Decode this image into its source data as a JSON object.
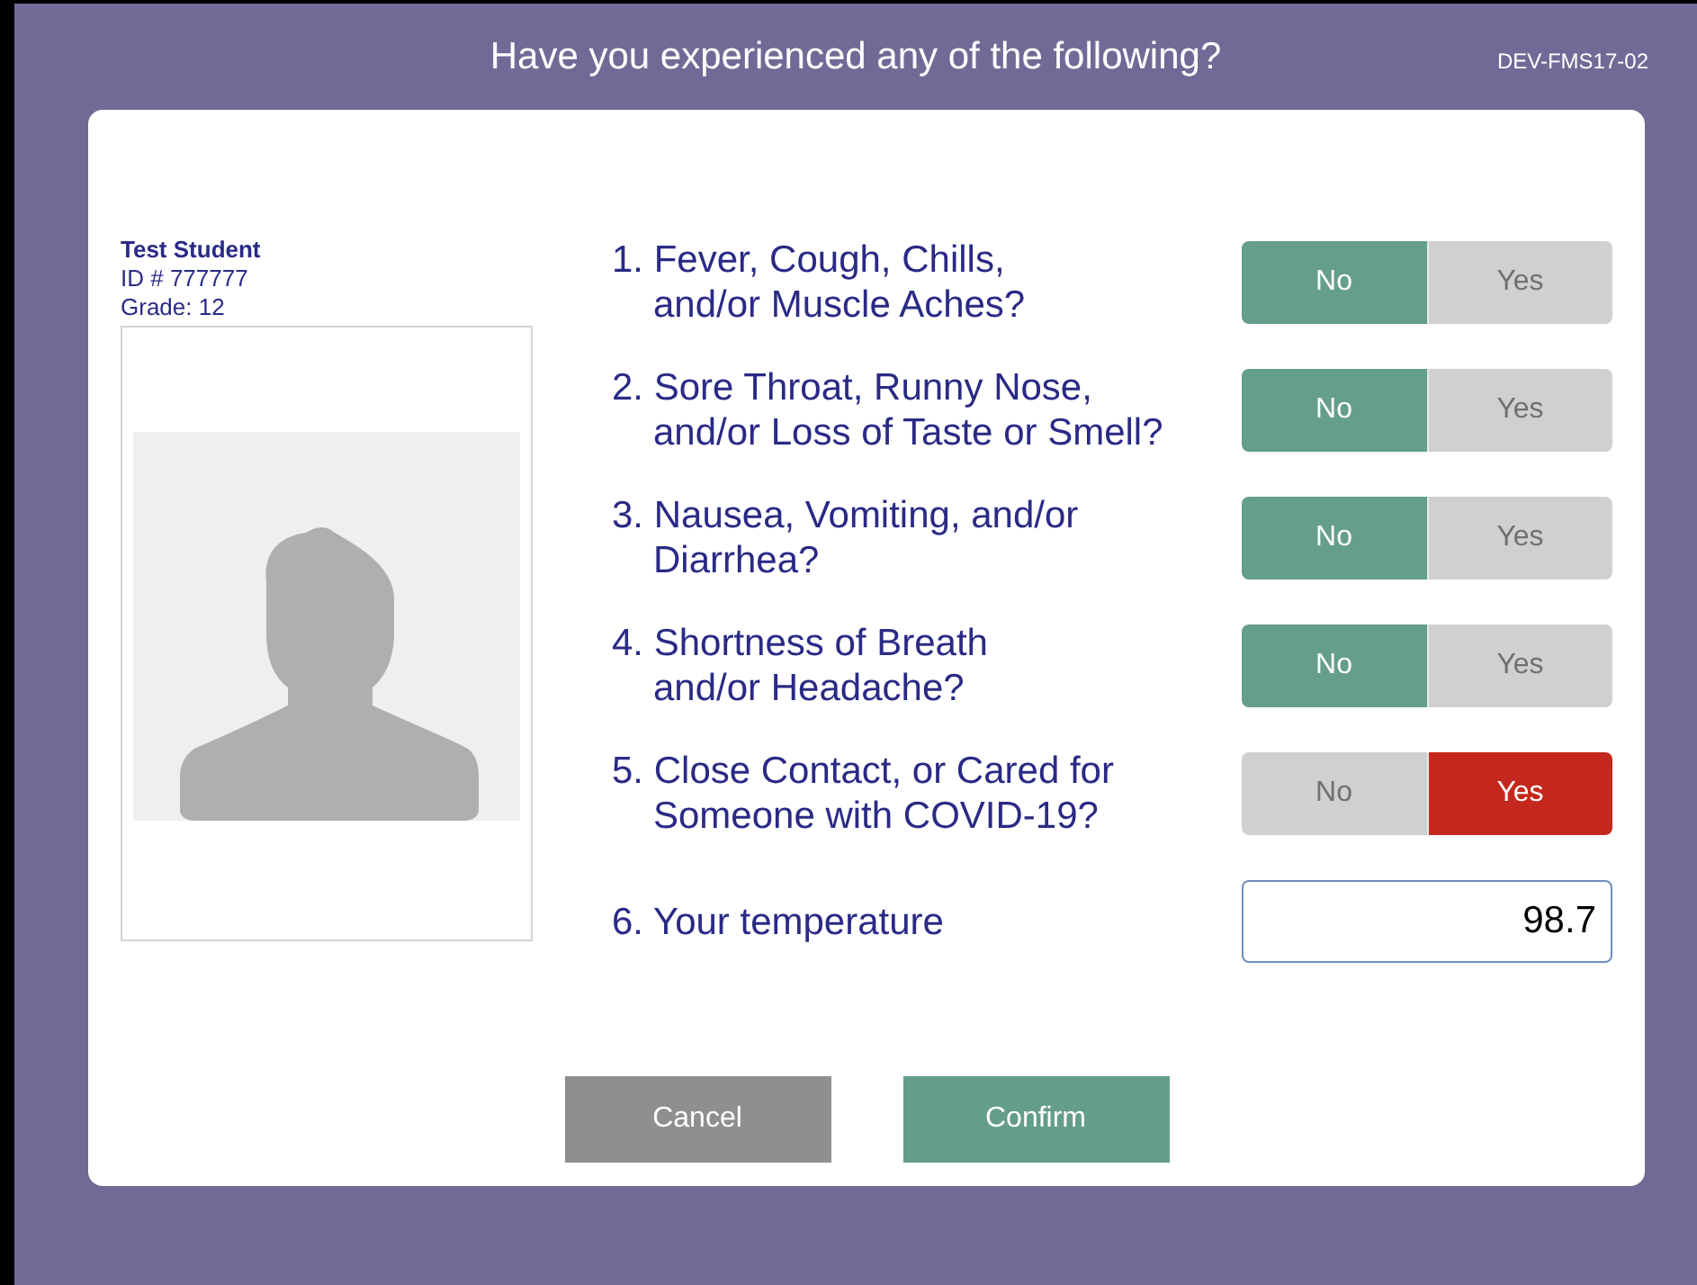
{
  "header": {
    "title": "Have you experienced any of the following?",
    "device_code": "DEV-FMS17-02"
  },
  "student": {
    "name": "Test Student",
    "id": "ID # 777777",
    "grade": "Grade: 12"
  },
  "questions": [
    {
      "kind": "toggle",
      "number": "1.",
      "lines": [
        "Fever, Cough, Chills,",
        "and/or Muscle Aches?"
      ],
      "options": [
        {
          "label": "No",
          "selected": true
        },
        {
          "label": "Yes",
          "selected": false
        }
      ]
    },
    {
      "kind": "toggle",
      "number": "2.",
      "lines": [
        "Sore Throat, Runny Nose,",
        "and/or Loss of Taste or Smell?"
      ],
      "options": [
        {
          "label": "No",
          "selected": true
        },
        {
          "label": "Yes",
          "selected": false
        }
      ]
    },
    {
      "kind": "toggle",
      "number": "3.",
      "lines": [
        "Nausea, Vomiting, and/or",
        "Diarrhea?"
      ],
      "options": [
        {
          "label": "No",
          "selected": true
        },
        {
          "label": "Yes",
          "selected": false
        }
      ]
    },
    {
      "kind": "toggle",
      "number": "4.",
      "lines": [
        "Shortness of Breath",
        "and/or Headache?"
      ],
      "options": [
        {
          "label": "No",
          "selected": true
        },
        {
          "label": "Yes",
          "selected": false
        }
      ]
    },
    {
      "kind": "toggle",
      "number": "5.",
      "lines": [
        "Close Contact, or Cared for",
        "Someone with COVID-19?"
      ],
      "options": [
        {
          "label": "No",
          "selected": false
        },
        {
          "label": "Yes",
          "selected": true
        }
      ]
    },
    {
      "kind": "input",
      "number": "6.",
      "lines": [
        "Your temperature"
      ],
      "value": "98.7"
    }
  ],
  "buttons": [
    {
      "label": "Cancel",
      "kind": "secondary"
    },
    {
      "label": "Confirm",
      "kind": "primary"
    }
  ]
}
